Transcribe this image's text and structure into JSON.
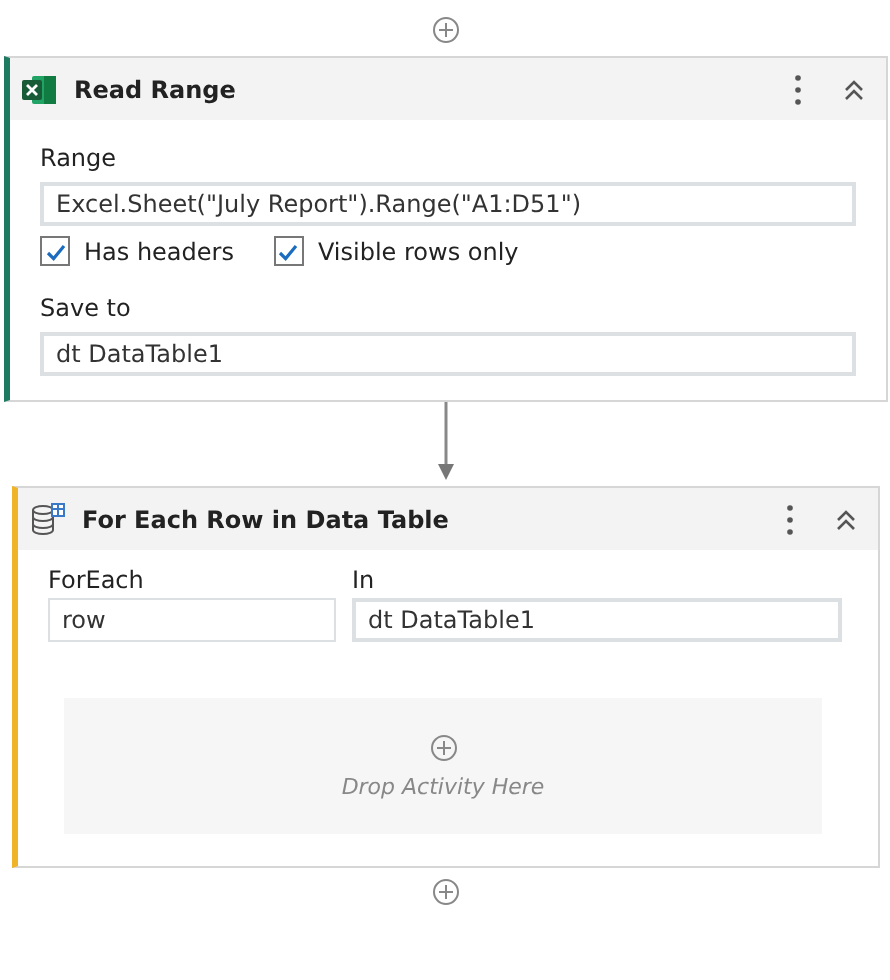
{
  "activities": [
    {
      "kind": "read_range",
      "title": "Read Range",
      "fields": [
        {
          "label": "Range",
          "value": "Excel.Sheet(\"July Report\").Range(\"A1:D51\")"
        }
      ],
      "checkboxes": [
        {
          "label": "Has headers",
          "checked": true
        },
        {
          "label": "Visible rows only",
          "checked": true
        }
      ],
      "save": {
        "label": "Save to",
        "value": "dt DataTable1"
      }
    },
    {
      "kind": "for_each_row",
      "title": "For Each Row in Data Table",
      "foreach": {
        "label": "ForEach",
        "value": "row"
      },
      "in": {
        "label": "In",
        "value": "dt DataTable1"
      },
      "drop_zone": {
        "text": "Drop Activity Here"
      }
    }
  ]
}
